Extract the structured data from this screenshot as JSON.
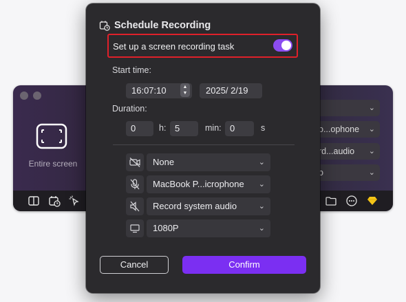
{
  "background_window": {
    "entire_screen_label": "Entire screen",
    "right_dropdowns": [
      "",
      "o...ophone",
      "rd...audio",
      "o"
    ]
  },
  "modal": {
    "title": "Schedule Recording",
    "task_label": "Set up a screen recording task",
    "task_enabled": true,
    "start_time_label": "Start time:",
    "start_time_value": "16:07:10",
    "start_date_value": "2025/ 2/19",
    "duration_label": "Duration:",
    "duration_hours": "0",
    "hours_unit": "h:",
    "duration_minutes": "5",
    "minutes_unit": "min:",
    "duration_seconds": "0",
    "seconds_unit": "s",
    "options": {
      "camera": "None",
      "microphone": "MacBook P...icrophone",
      "system_audio": "Record system audio",
      "resolution": "1080P"
    },
    "cancel_label": "Cancel",
    "confirm_label": "Confirm"
  },
  "colors": {
    "accent": "#7b2ff2",
    "toggle_on": "#8b4cf0",
    "highlight_border": "#e0202a",
    "modal_bg": "#2b2a2d"
  }
}
